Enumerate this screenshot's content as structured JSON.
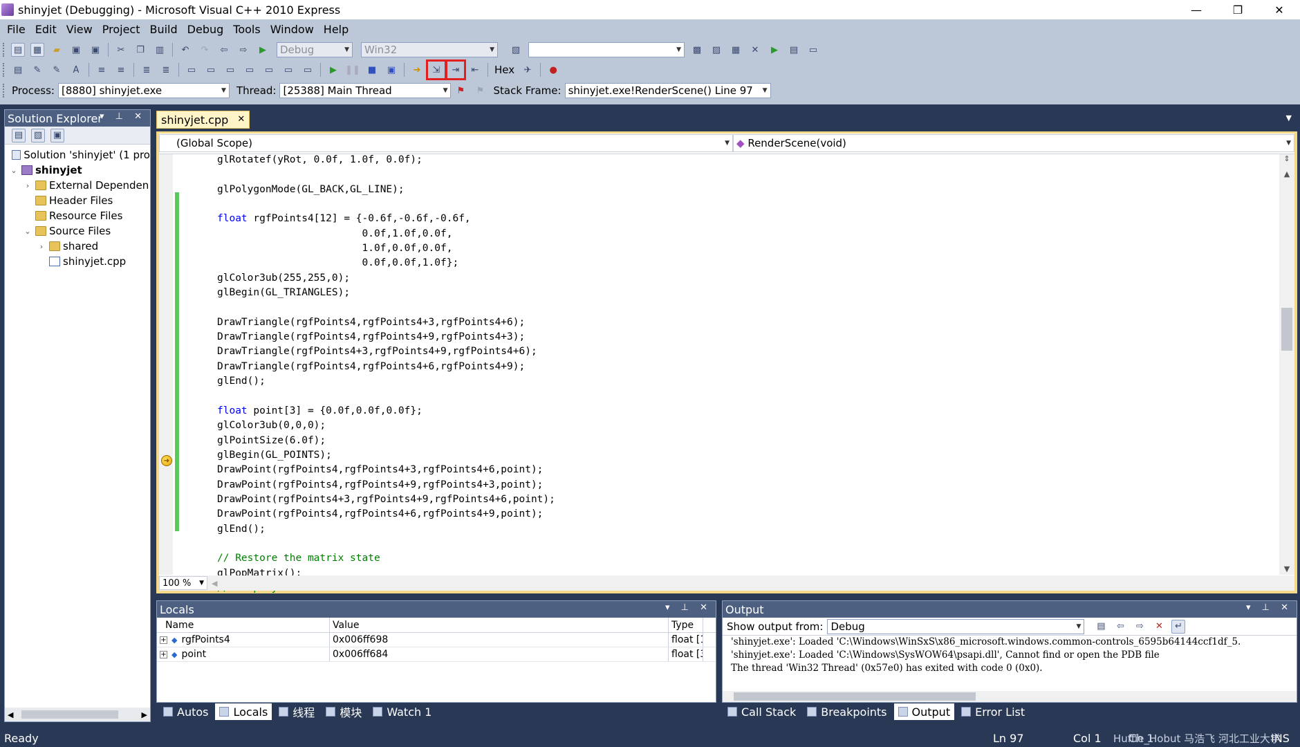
{
  "window": {
    "title": "shinyjet (Debugging) - Microsoft Visual C++ 2010 Express",
    "minimize": "—",
    "restore": "❐",
    "close": "✕"
  },
  "menu": [
    "File",
    "Edit",
    "View",
    "Project",
    "Build",
    "Debug",
    "Tools",
    "Window",
    "Help"
  ],
  "toolbar1": {
    "config": "Debug",
    "platform": "Win32",
    "find": ""
  },
  "toolbar2": {
    "hex": "Hex"
  },
  "debugbar": {
    "process_label": "Process:",
    "process": "[8880] shinyjet.exe",
    "thread_label": "Thread:",
    "thread": "[25388] Main Thread",
    "stack_label": "Stack Frame:",
    "stack": "shinyjet.exe!RenderScene()  Line 97"
  },
  "solution_explorer": {
    "title": "Solution Explorer",
    "items": [
      {
        "label": "Solution 'shinyjet' (1 pro"
      },
      {
        "label": "shinyjet"
      },
      {
        "label": "External Dependen"
      },
      {
        "label": "Header Files"
      },
      {
        "label": "Resource Files"
      },
      {
        "label": "Source Files"
      },
      {
        "label": "shared"
      },
      {
        "label": "shinyjet.cpp"
      }
    ]
  },
  "editor": {
    "tab": "shinyjet.cpp",
    "scope": "(Global Scope)",
    "member": "RenderScene(void)",
    "zoom": "100 %",
    "lines": [
      "glRotatef(yRot, 0.0f, 1.0f, 0.0f);",
      "",
      "glPolygonMode(GL_BACK,GL_LINE);",
      "",
      "float rgfPoints4[12] = {-0.6f,-0.6f,-0.6f,",
      "                        0.0f,1.0f,0.0f,",
      "                        1.0f,0.0f,0.0f,",
      "                        0.0f,0.0f,1.0f};",
      "glColor3ub(255,255,0);",
      "glBegin(GL_TRIANGLES);",
      "",
      "DrawTriangle(rgfPoints4,rgfPoints4+3,rgfPoints4+6);",
      "DrawTriangle(rgfPoints4,rgfPoints4+9,rgfPoints4+3);",
      "DrawTriangle(rgfPoints4+3,rgfPoints4+9,rgfPoints4+6);",
      "DrawTriangle(rgfPoints4,rgfPoints4+6,rgfPoints4+9);",
      "glEnd();",
      "",
      "float point[3] = {0.0f,0.0f,0.0f};",
      "glColor3ub(0,0,0);",
      "glPointSize(6.0f);",
      "glBegin(GL_POINTS);",
      "DrawPoint(rgfPoints4,rgfPoints4+3,rgfPoints4+6,point);",
      "DrawPoint(rgfPoints4,rgfPoints4+9,rgfPoints4+3,point);",
      "DrawPoint(rgfPoints4+3,rgfPoints4+9,rgfPoints4+6,point);",
      "DrawPoint(rgfPoints4,rgfPoints4+6,rgfPoints4+9,point);",
      "glEnd();",
      "",
      "// Restore the matrix state",
      "glPopMatrix();",
      "// Display the results"
    ]
  },
  "locals": {
    "title": "Locals",
    "columns": [
      "Name",
      "Value",
      "Type"
    ],
    "rows": [
      {
        "name": "rgfPoints4",
        "value": "0x006ff698",
        "type": "float [1"
      },
      {
        "name": "point",
        "value": "0x006ff684",
        "type": "float [3"
      }
    ]
  },
  "output": {
    "title": "Output",
    "show_from_label": "Show output from:",
    "show_from": "Debug",
    "lines": [
      "'shinyjet.exe': Loaded 'C:\\Windows\\WinSxS\\x86_microsoft.windows.common-controls_6595b64144ccf1df_5.",
      "'shinyjet.exe': Loaded 'C:\\Windows\\SysWOW64\\psapi.dll', Cannot find or open the PDB file",
      "The thread 'Win32 Thread' (0x57e0) has exited with code 0 (0x0)."
    ]
  },
  "bottom_tabs_left": [
    "Autos",
    "Locals",
    "线程",
    "模块",
    "Watch 1"
  ],
  "bottom_tabs_right": [
    "Call Stack",
    "Breakpoints",
    "Output",
    "Error List"
  ],
  "status": {
    "ready": "Ready",
    "ln": "Ln 97",
    "col": "Col 1",
    "ch": "Ch 1",
    "ins": "INS",
    "watermark": "Huffie_Hobut  马浩飞 河北工业大学"
  }
}
